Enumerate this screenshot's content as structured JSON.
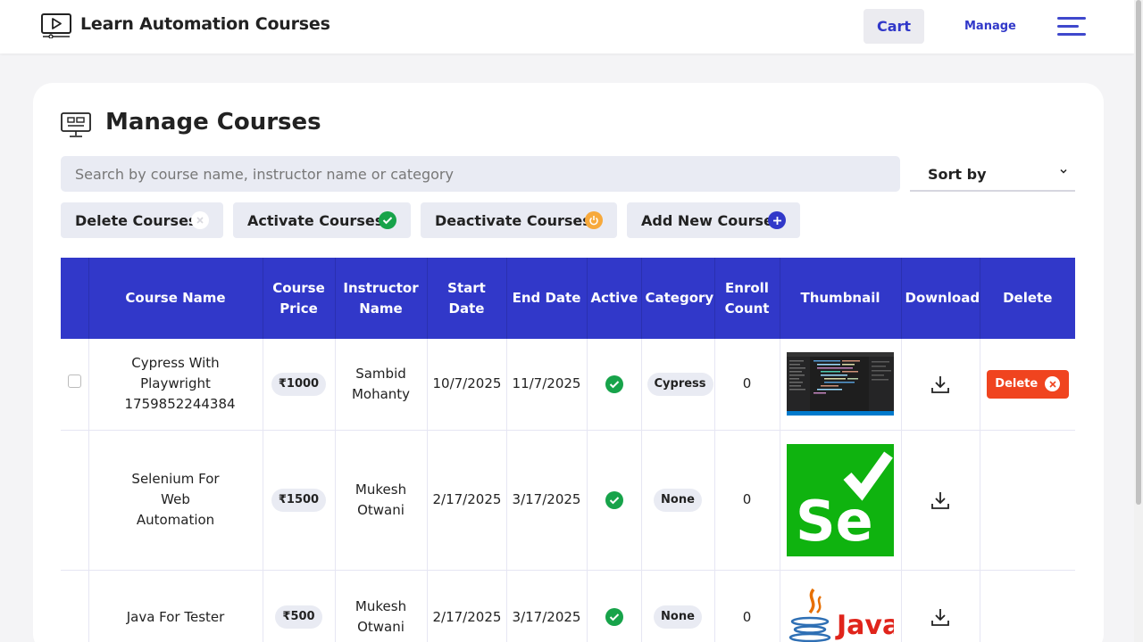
{
  "header": {
    "brand_title": "Learn Automation Courses",
    "cart_label": "Cart",
    "manage_label": "Manage",
    "brand_icon": "video-monitor-icon",
    "menu_icon": "hamburger-menu-icon"
  },
  "page": {
    "title": "Manage Courses",
    "title_icon": "computer-course-icon",
    "search_placeholder": "Search by course name, instructor name or category",
    "sort_label": "Sort by"
  },
  "actions": {
    "delete": "Delete Courses",
    "activate": "Activate Courses",
    "deactivate": "Deactivate Courses",
    "add": "Add New Course"
  },
  "colors": {
    "accent": "#3138c9",
    "delete": "#f0441f",
    "active_green": "#17a34a",
    "deactivate_orange": "#f7a93b"
  },
  "table": {
    "headers": [
      "",
      "Course Name",
      "Course Price",
      "Instructor Name",
      "Start Date",
      "End Date",
      "Active",
      "Category",
      "Enroll Count",
      "Thumbnail",
      "Download",
      "Delete"
    ],
    "rows": [
      {
        "name": "Cypress With Playwright 1759852244384",
        "price": "₹1000",
        "instructor": "Sambid Mohanty",
        "start": "10/7/2025",
        "end": "11/7/2025",
        "active": true,
        "category": "Cypress",
        "enroll": "0",
        "thumbnail": "code-editor-thumbnail",
        "delete_label": "Delete"
      },
      {
        "name": "Selenium For Web Automation",
        "price": "₹1500",
        "instructor": "Mukesh Otwani",
        "start": "2/17/2025",
        "end": "3/17/2025",
        "active": true,
        "category": "None",
        "enroll": "0",
        "thumbnail": "selenium-logo-thumbnail",
        "thumbnail_text": "Se"
      },
      {
        "name": "Java For Tester",
        "price": "₹500",
        "instructor": "Mukesh Otwani",
        "start": "2/17/2025",
        "end": "3/17/2025",
        "active": true,
        "category": "None",
        "enroll": "0",
        "thumbnail": "java-logo-thumbnail",
        "thumbnail_text": "Java"
      }
    ]
  }
}
